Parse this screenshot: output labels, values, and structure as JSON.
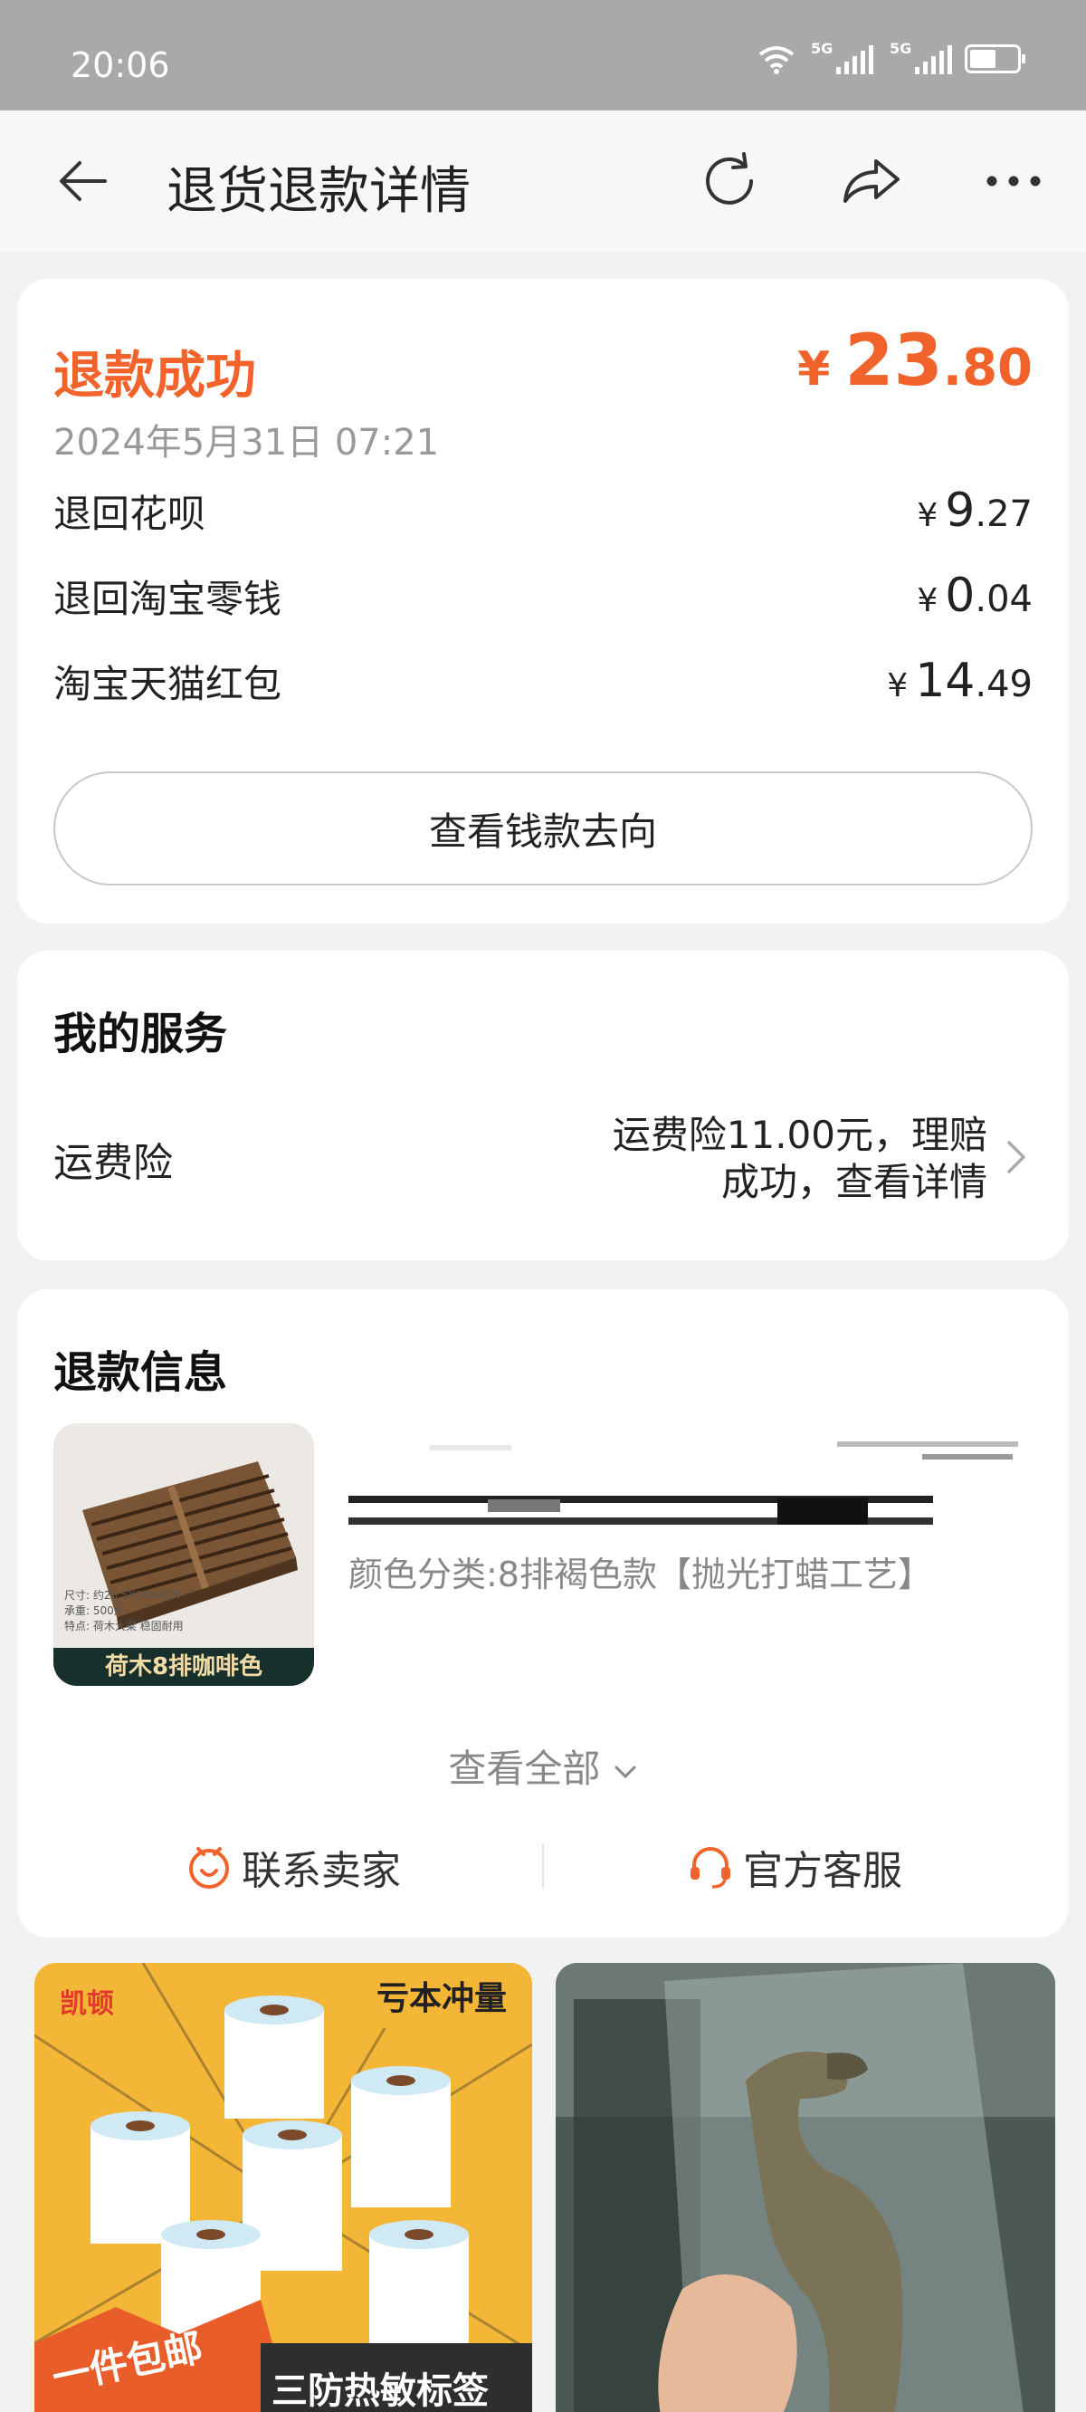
{
  "status_bar": {
    "time": "20:06"
  },
  "header": {
    "title": "退货退款详情"
  },
  "refund": {
    "status": "退款成功",
    "currency": "¥",
    "total_int": "23",
    "total_dec": ".80",
    "time": "2024年5月31日 07:21",
    "breakdown": [
      {
        "label": "退回花呗",
        "currency": "¥",
        "int": "9",
        "dec": ".27"
      },
      {
        "label": "退回淘宝零钱",
        "currency": "¥",
        "int": "0",
        "dec": ".04"
      },
      {
        "label": "淘宝天猫红包",
        "currency": "¥",
        "int": "14",
        "dec": ".49"
      }
    ],
    "view_flow_label": "查看钱款去向"
  },
  "services": {
    "title": "我的服务",
    "item_label": "运费险",
    "item_value_line1": "运费险11.00元，理赔",
    "item_value_line2": "成功，查看详情"
  },
  "refund_info": {
    "title": "退款信息",
    "product": {
      "thumb_caption": "荷木8排咖啡色",
      "thumb_spec_line1": "尺寸: 约26.5X20X4CM",
      "thumb_spec_line2": "承重: 500斤",
      "thumb_spec_line3": "特点: 荷木大梁 稳固耐用",
      "spec": "颜色分类:8排褐色款【抛光打蜡工艺】"
    },
    "view_all": "查看全部",
    "contact_seller": "联系卖家",
    "official_service": "官方客服"
  },
  "recommendations": [
    {
      "brand": "凯顿",
      "badge": "亏本冲量",
      "promo": "一件包邮",
      "slogan": "三防热敏标签"
    },
    {}
  ],
  "colors": {
    "accent": "#f2632c",
    "status_bar": "#a9a9a9"
  }
}
